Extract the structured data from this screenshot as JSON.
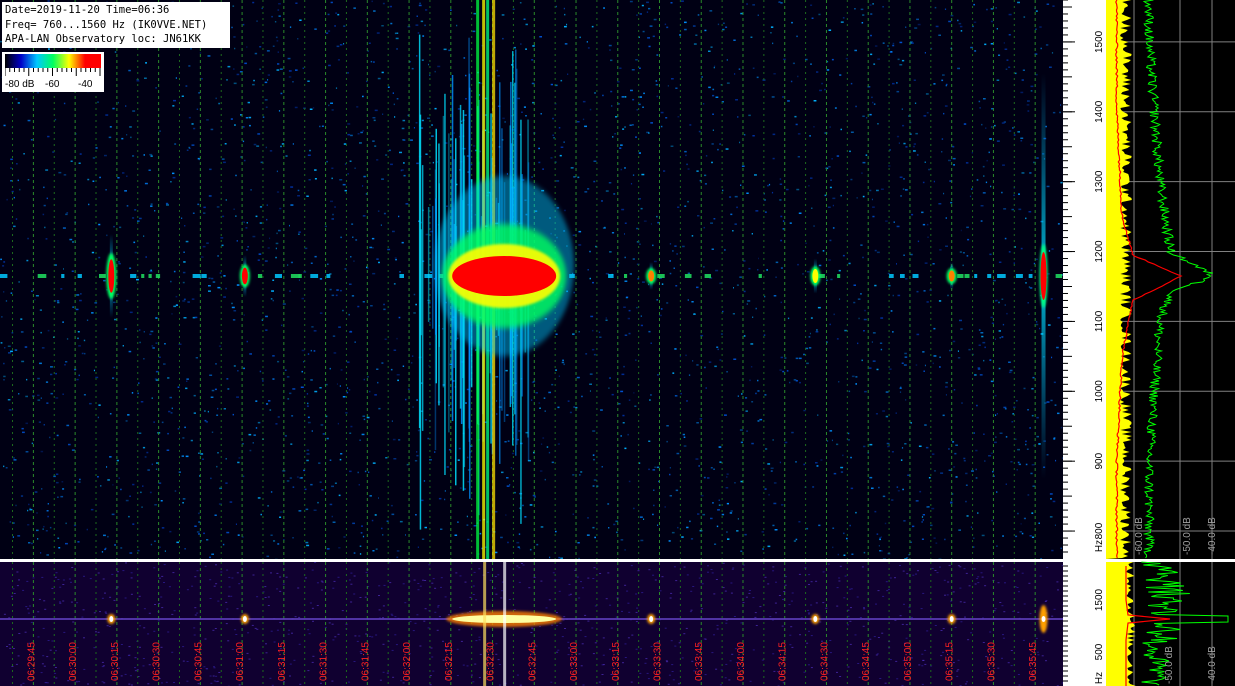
{
  "header": {
    "line1": "Date=2019-11-20 Time=06:36",
    "line2": "Freq= 760...1560 Hz (IK0VVE.NET)",
    "line3": "APA-LAN Observatory loc: JN61KK"
  },
  "colorbar": {
    "labels": [
      "-80 dB",
      "-60",
      "-40"
    ],
    "colors": [
      "#000000",
      "#0000c8",
      "#00c8ff",
      "#00ff60",
      "#ffff00",
      "#ff0000",
      "#ff0000"
    ]
  },
  "chart_data": [
    {
      "type": "heatmap",
      "title": "",
      "xlabel": "",
      "ylabel": "Hz",
      "y_axis": {
        "range": [
          760,
          1560
        ],
        "ticks": [
          800,
          900,
          1000,
          1100,
          1200,
          1300,
          1400,
          1500
        ],
        "tick_labels": [
          "800",
          "900",
          "1000",
          "1100",
          "1200",
          "1300",
          "1400",
          "1500"
        ],
        "unit": "Hz"
      },
      "x_axis": {
        "range": [
          "06:29:33",
          "06:35:55"
        ],
        "ticks": [
          "06:29:45",
          "06:30:00",
          "06:30:15",
          "06:30:30",
          "06:30:45",
          "06:31:00",
          "06:31:15",
          "06:31:30",
          "06:31:45",
          "06:32:00",
          "06:32:15",
          "06:32:30",
          "06:32:45",
          "06:33:00",
          "06:33:15",
          "06:33:30",
          "06:33:45",
          "06:34:00",
          "06:34:15",
          "06:34:30",
          "06:34:45",
          "06:35:00",
          "06:35:15",
          "06:35:30",
          "06:35:45"
        ]
      },
      "carrier_hz": 1165,
      "color_scale_db": [
        -80,
        -40
      ],
      "events": [
        {
          "time": "06:30:13",
          "peak_db": -40,
          "spread_hz": 120
        },
        {
          "time": "06:31:01",
          "peak_db": -42,
          "spread_hz": 60
        },
        {
          "time": "06:32:18",
          "peak_db": -40,
          "spread_hz": 500
        },
        {
          "time": "06:33:27",
          "peak_db": -44,
          "spread_hz": 40
        },
        {
          "time": "06:34:26",
          "peak_db": -46,
          "spread_hz": 50
        },
        {
          "time": "06:35:15",
          "peak_db": -44,
          "spread_hz": 40
        },
        {
          "time": "06:35:48",
          "peak_db": -40,
          "spread_hz": 580
        }
      ]
    },
    {
      "type": "line",
      "title": "",
      "orientation": "frequency-vertical",
      "x_axis_labels": [
        "-60.0 dB",
        "-50.0 dB",
        "-40.0 dB"
      ],
      "xlim": [
        -62,
        -38
      ],
      "ylim": [
        760,
        1560
      ],
      "series": [
        {
          "name": "",
          "color": "#ffff00",
          "values_note": "noise",
          "level_db": -61
        },
        {
          "name": "",
          "color": "#00ff00",
          "x": [
            -54,
            -54,
            -53,
            -52,
            -50,
            -42,
            -50,
            -52,
            -53,
            -54,
            -54
          ],
          "y": [
            770,
            900,
            1000,
            1100,
            1140,
            1165,
            1200,
            1300,
            1400,
            1500,
            1560
          ]
        },
        {
          "name": "",
          "color": "#ff0000",
          "x": [
            -60,
            -60,
            -59,
            -57,
            -48,
            -57,
            -59,
            -60,
            -60
          ],
          "y": [
            770,
            900,
            1050,
            1130,
            1165,
            1195,
            1250,
            1400,
            1560
          ]
        }
      ]
    },
    {
      "type": "heatmap",
      "title": "",
      "ylabel": "Hz",
      "y_axis": {
        "tick_labels": [
          "500",
          "1500"
        ],
        "unit": "Hz"
      },
      "x_axis": {
        "ticks": [
          "06:29:45",
          "06:30:00",
          "06:30:15",
          "06:30:30",
          "06:30:45",
          "06:31:00",
          "06:31:15",
          "06:31:30",
          "06:31:45",
          "06:32:00",
          "06:32:15",
          "06:32:30",
          "06:32:45",
          "06:33:00",
          "06:33:15",
          "06:33:30",
          "06:33:45",
          "06:34:00",
          "06:34:15",
          "06:34:30",
          "06:34:45",
          "06:35:00",
          "06:35:15",
          "06:35:30",
          "06:35:45"
        ]
      }
    },
    {
      "type": "line",
      "title": "",
      "x_axis_labels": [
        "-50.0 dB",
        "-40.0 dB"
      ],
      "series": [
        {
          "name": "",
          "color": "#ffff00"
        },
        {
          "name": "",
          "color": "#00ff00"
        },
        {
          "name": "",
          "color": "#ff0000"
        }
      ]
    }
  ],
  "axis_labels": {
    "main_hz": "Hz",
    "mini_hz": "Hz"
  }
}
